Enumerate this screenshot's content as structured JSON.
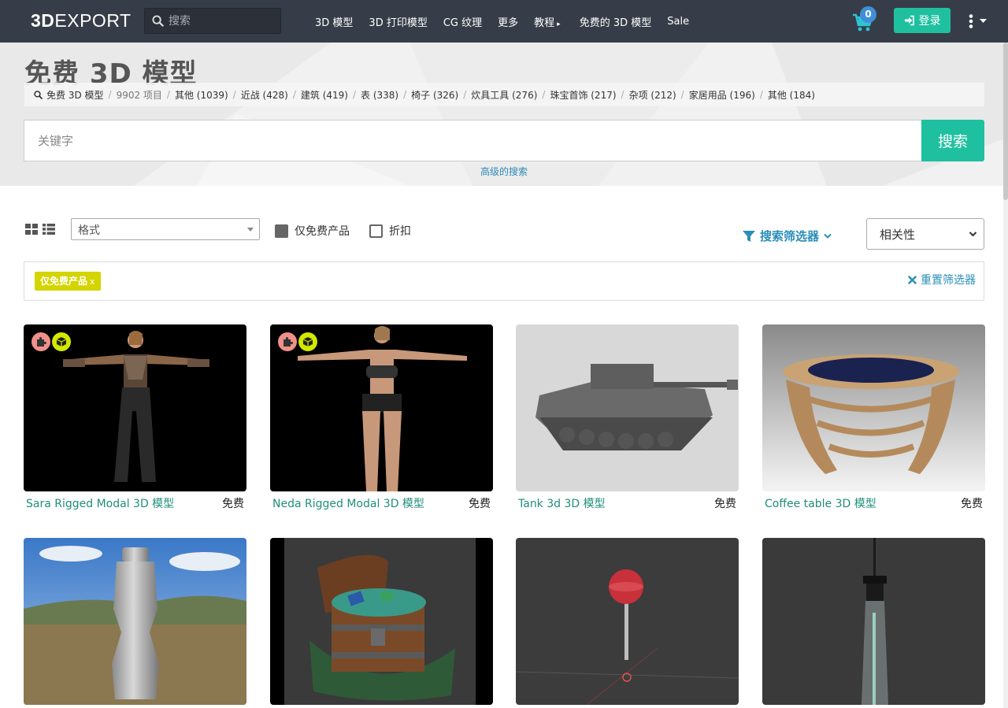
{
  "nav": {
    "logo_bold": "3D",
    "logo_rest": "EXPORT",
    "search_placeholder": "搜索",
    "menu": [
      "3D 模型",
      "3D 打印模型",
      "CG 纹理",
      "更多",
      "教程",
      "免费的 3D 模型",
      "Sale"
    ],
    "cart_count": "0",
    "login_label": "登录"
  },
  "hero": {
    "title": "免费 3D 模型",
    "crumbs": [
      {
        "label": "免费 3D 模型"
      },
      {
        "label": "9902 项目"
      },
      {
        "label": "其他 (1039)"
      },
      {
        "label": "近战 (428)"
      },
      {
        "label": "建筑 (419)"
      },
      {
        "label": "表 (338)"
      },
      {
        "label": "椅子 (326)"
      },
      {
        "label": "炊具工具 (276)"
      },
      {
        "label": "珠宝首饰 (217)"
      },
      {
        "label": "杂项 (212)"
      },
      {
        "label": "家居用品 (196)"
      },
      {
        "label": "其他 (184)"
      }
    ],
    "search_placeholder": "关键字",
    "search_button": "搜索",
    "advanced_link": "高级的搜索"
  },
  "filters": {
    "format_placeholder": "格式",
    "free_only_label": "仅免费产品",
    "free_only_checked": true,
    "discount_label": "折扣",
    "discount_checked": false,
    "filter_toggle": "搜索筛选器",
    "sort_selected": "相关性",
    "active_tag": "仅免费产品",
    "active_tag_remove": "x",
    "reset_label": "重置筛选器"
  },
  "products": [
    {
      "name": "Sara Rigged Modal 3D 模型",
      "price": "免费",
      "icon": "rigged-woman-clothed",
      "badges": true
    },
    {
      "name": "Neda Rigged Modal 3D 模型",
      "price": "免费",
      "icon": "rigged-woman-underwear",
      "badges": true
    },
    {
      "name": "Tank 3d 3D 模型",
      "price": "免费",
      "icon": "tiger-tank",
      "badges": false
    },
    {
      "name": "Coffee table 3D 模型",
      "price": "免费",
      "icon": "coffee-table",
      "badges": false
    },
    {
      "name": "",
      "price": "",
      "icon": "bottle-landscape",
      "badges": false
    },
    {
      "name": "",
      "price": "",
      "icon": "treasure-chest",
      "badges": false
    },
    {
      "name": "",
      "price": "",
      "icon": "lollipop",
      "badges": false
    },
    {
      "name": "",
      "price": "",
      "icon": "pendant-lamp",
      "badges": false
    }
  ],
  "colors": {
    "nav_bg": "#373d48",
    "accent_green": "#1fc0a0",
    "link_blue": "#2a8fb8",
    "product_link": "#1f8e7a",
    "tag_yellow": "#d4d400"
  }
}
